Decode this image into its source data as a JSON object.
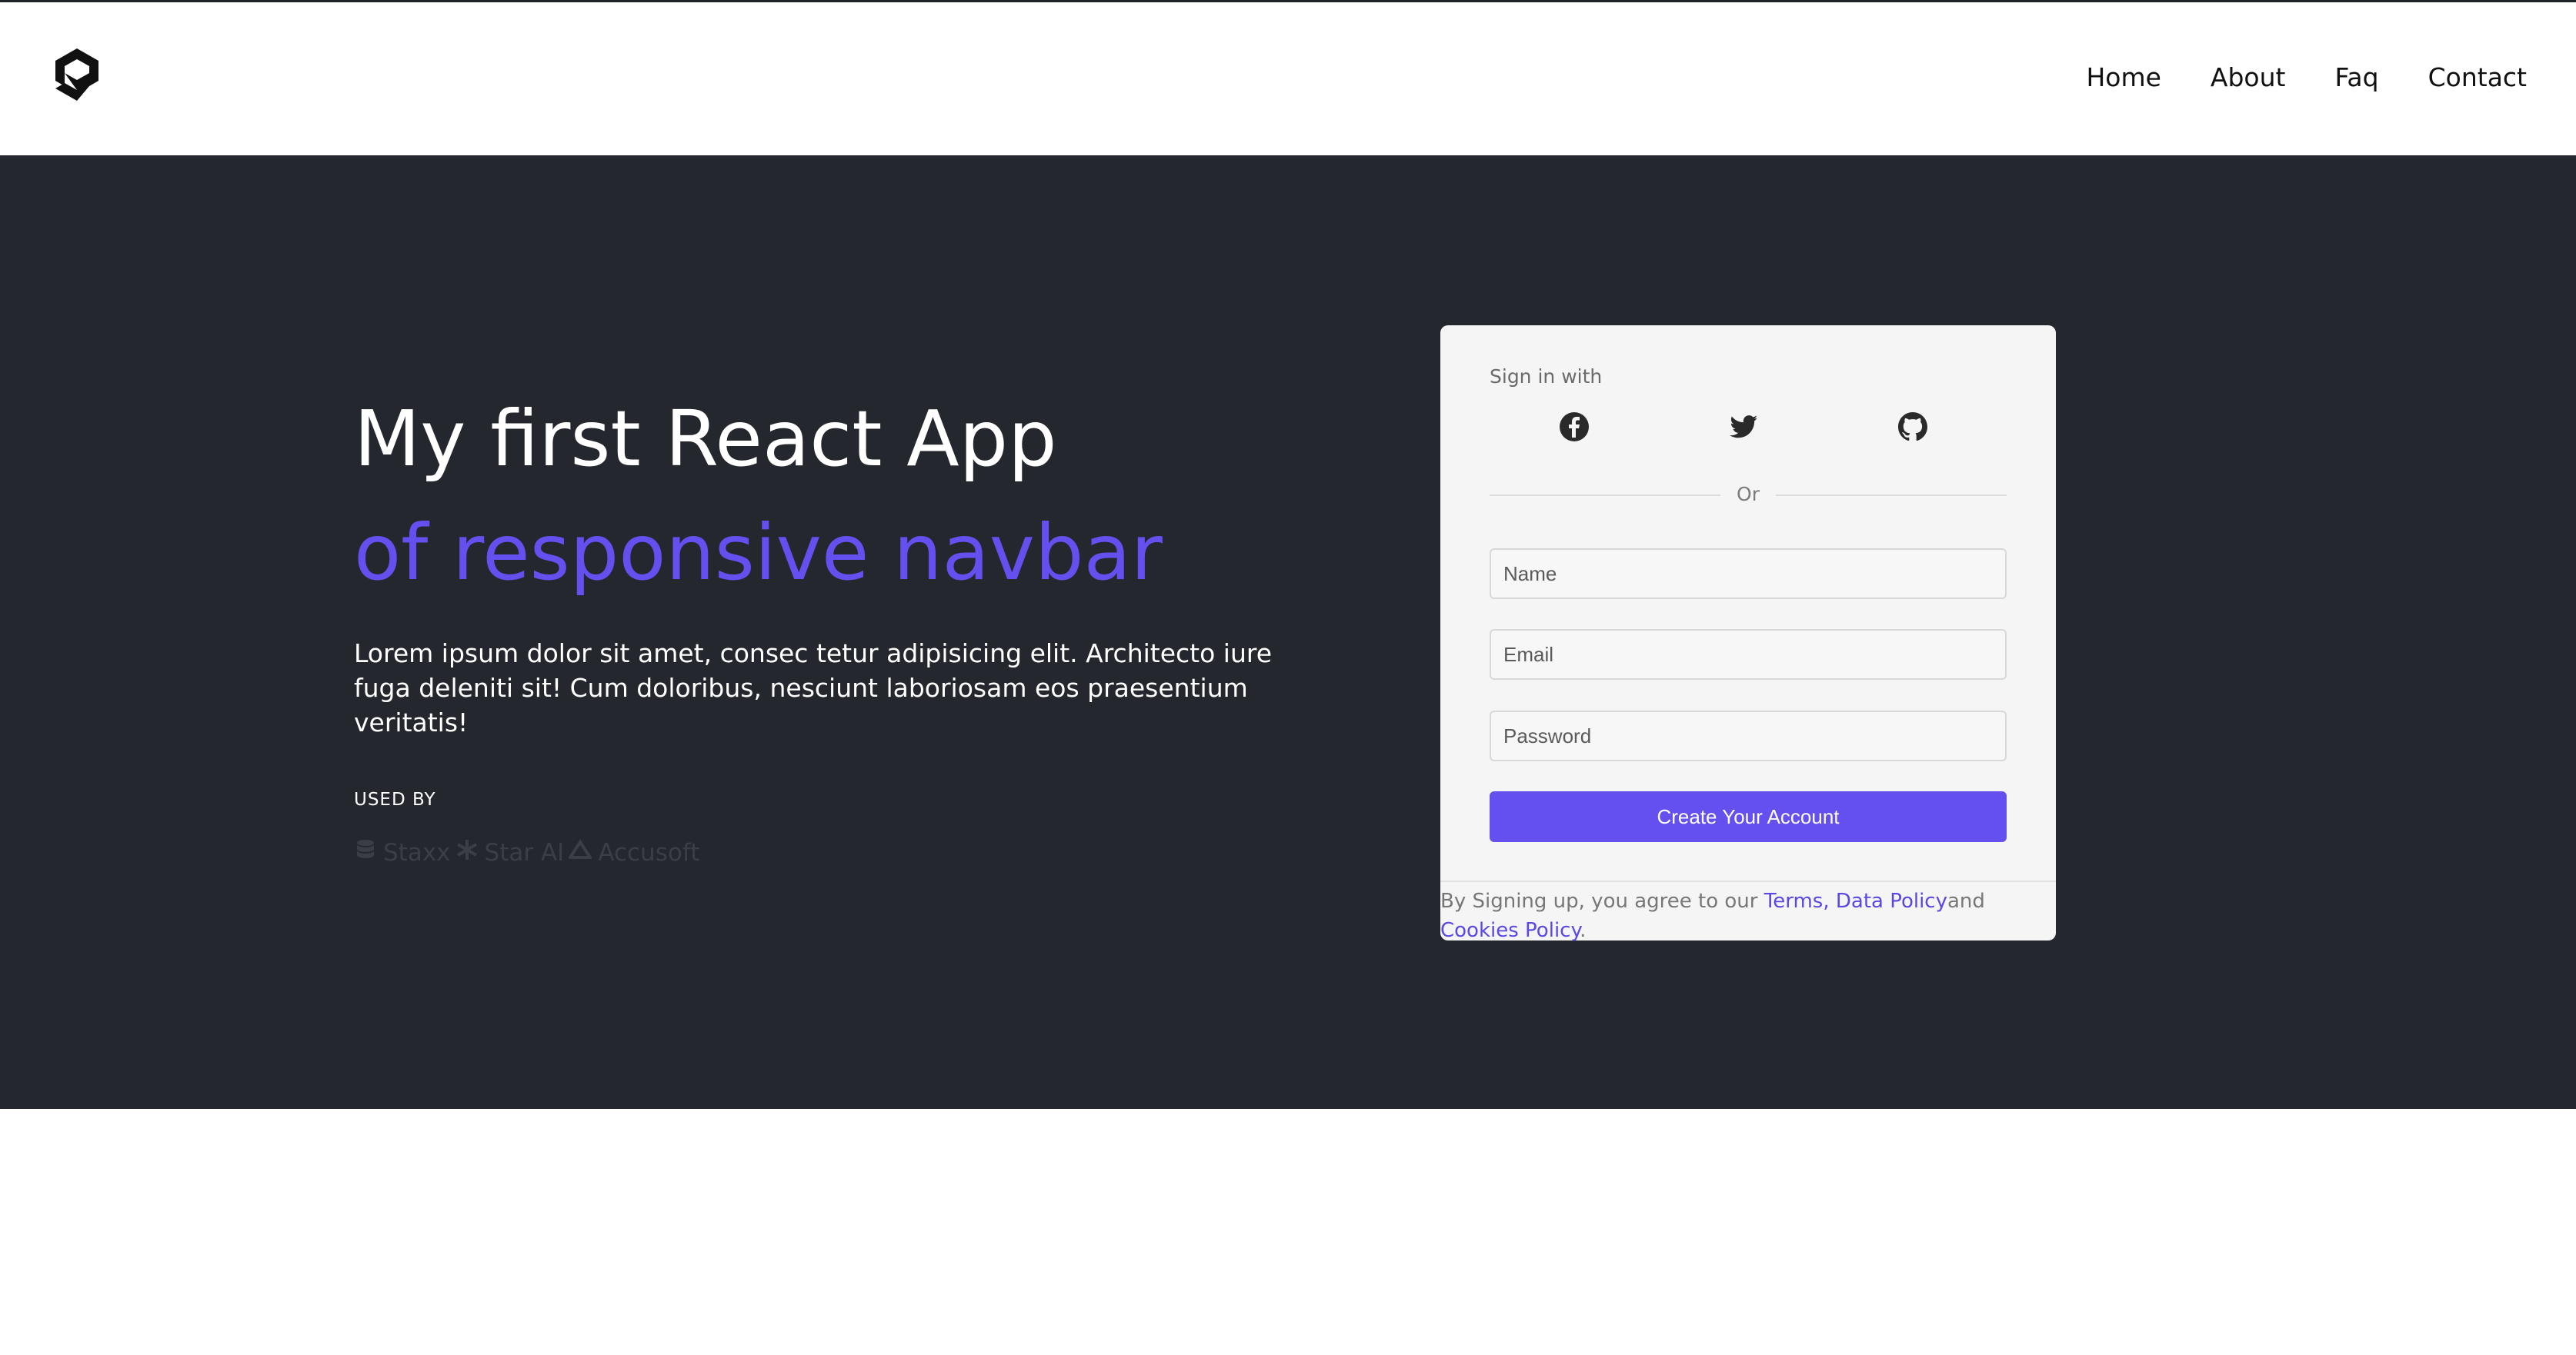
{
  "nav": {
    "items": [
      {
        "label": "Home"
      },
      {
        "label": "About"
      },
      {
        "label": "Faq"
      },
      {
        "label": "Contact"
      }
    ]
  },
  "hero": {
    "title": "My first React App",
    "subtitle": "of responsive navbar",
    "description": "Lorem ipsum dolor sit amet, consec tetur adipisicing elit. Architecto iure fuga deleniti sit! Cum doloribus, nesciunt laboriosam eos praesentium veritatis!",
    "used_by_label": "USED BY",
    "brands": [
      {
        "name": "Staxx",
        "icon": "database-icon"
      },
      {
        "name": "Star AI",
        "icon": "asterisk-icon"
      },
      {
        "name": "Accusoft",
        "icon": "triangle-icon"
      }
    ]
  },
  "signup": {
    "signin_label": "Sign in with",
    "social": [
      {
        "icon": "facebook-icon"
      },
      {
        "icon": "twitter-icon"
      },
      {
        "icon": "github-icon"
      }
    ],
    "or_label": "Or",
    "name_placeholder": "Name",
    "email_placeholder": "Email",
    "password_placeholder": "Password",
    "submit_label": "Create Your Account",
    "terms_prefix": "By Signing up, you agree to our ",
    "terms_link": "Terms,",
    "data_policy_link": "Data Policy",
    "and_text": "and",
    "cookies_link": "Cookies Policy",
    "period": "."
  },
  "colors": {
    "accent": "#6350ee",
    "hero_bg": "#24272d",
    "card_bg": "#f5f5f5"
  }
}
